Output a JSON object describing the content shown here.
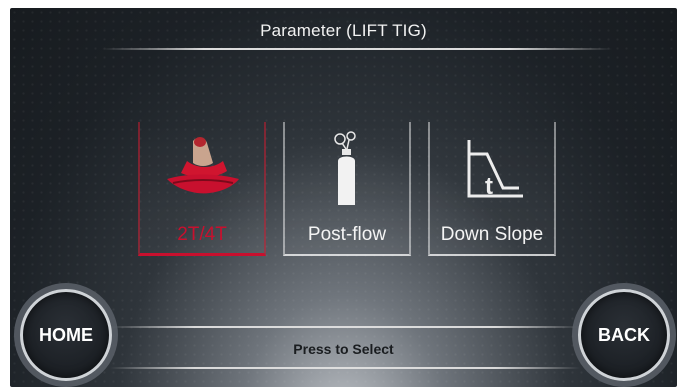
{
  "header": {
    "title": "Parameter (LIFT TIG)"
  },
  "options": [
    {
      "label": "2T/4T",
      "icon": "trigger-hand-icon",
      "active": true
    },
    {
      "label": "Post-flow",
      "icon": "gas-cylinder-icon",
      "active": false
    },
    {
      "label": "Down Slope",
      "icon": "down-slope-graph-icon",
      "active": false
    }
  ],
  "footer": {
    "home_label": "HOME",
    "back_label": "BACK",
    "hint": "Press to Select"
  },
  "colors": {
    "accent": "#c8102e",
    "text": "#f4f4f4",
    "background": "#1c2126"
  }
}
